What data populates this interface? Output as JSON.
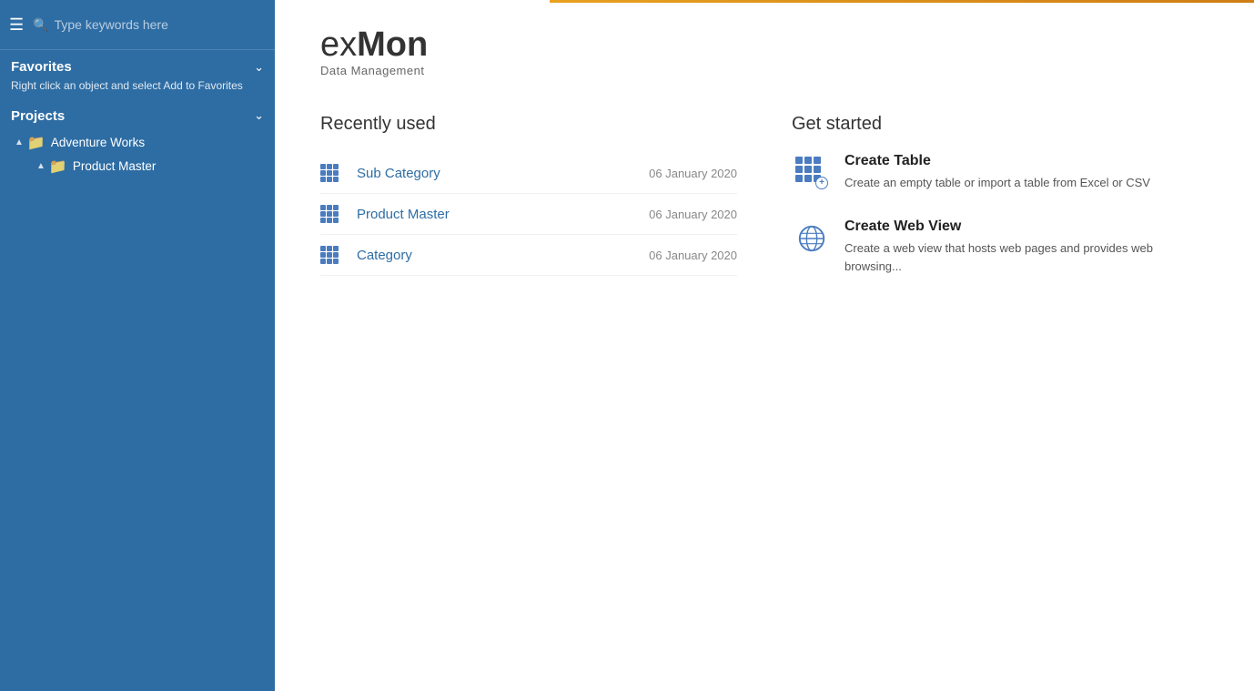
{
  "sidebar": {
    "search_placeholder": "Type keywords here",
    "favorites": {
      "title": "Favorites",
      "hint": "Right click an object and select Add to Favorites"
    },
    "projects": {
      "title": "Projects",
      "items": [
        {
          "label": "Adventure Works",
          "type": "parent",
          "children": [
            {
              "label": "Product Master",
              "type": "child"
            }
          ]
        }
      ]
    }
  },
  "logo": {
    "ex": "ex",
    "mon": "Mon",
    "sub": "Data Management"
  },
  "recently_used": {
    "section_title": "Recently used",
    "items": [
      {
        "name": "Sub Category",
        "date": "06 January 2020"
      },
      {
        "name": "Product Master",
        "date": "06 January 2020"
      },
      {
        "name": "Category",
        "date": "06 January 2020"
      }
    ]
  },
  "get_started": {
    "section_title": "Get started",
    "items": [
      {
        "title": "Create Table",
        "desc": "Create an empty table or import a table from Excel or CSV"
      },
      {
        "title": "Create Web View",
        "desc": "Create a web view that hosts web pages and provides web browsing..."
      }
    ]
  }
}
